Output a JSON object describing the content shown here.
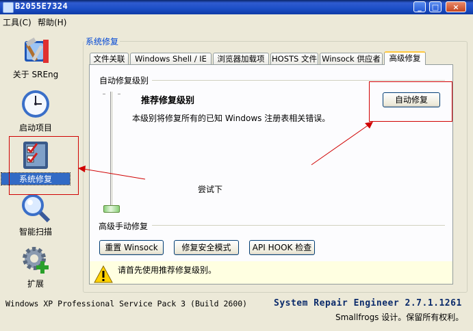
{
  "window": {
    "title": "B2055E7324",
    "controls": {
      "minimize": "_",
      "maximize": "□",
      "close": "×"
    }
  },
  "menu": [
    "工具(C)",
    "帮助(H)"
  ],
  "nav": [
    {
      "label": "关于 SREng",
      "icon": "hammer-wrench-icon"
    },
    {
      "label": "启动项目",
      "icon": "clock-icon"
    },
    {
      "label": "系统修复",
      "icon": "checklist-icon",
      "selected": true
    },
    {
      "label": "智能扫描",
      "icon": "magnifier-icon"
    },
    {
      "label": "扩展",
      "icon": "gear-plus-icon"
    }
  ],
  "group": {
    "title": "系统修复"
  },
  "tabs": [
    "文件关联",
    "Windows Shell / IE",
    "浏览器加载项",
    "HOSTS 文件",
    "Winsock 供应者",
    "高级修复"
  ],
  "auto_repair": {
    "section_label": "自动修复级别",
    "level_title": "推荐修复级别",
    "level_desc": "本级别将修复所有的已知 Windows 注册表相关错误。",
    "button": "自动修复"
  },
  "annotation": {
    "text": "尝试下"
  },
  "manual_repair": {
    "section_label": "高级手动修复",
    "buttons": [
      "重置 Winsock",
      "修复安全模式",
      "API HOOK 检查"
    ]
  },
  "notice": {
    "text": "请首先使用推荐修复级别。",
    "icon": "warning-icon"
  },
  "status": {
    "os": "Windows XP Professional Service Pack 3 (Build 2600)",
    "product": "System Repair Engineer 2.7.1.1261",
    "copyright": "Smallfrogs 设计。保留所有权利。"
  },
  "colors": {
    "accent": "#0046d5",
    "annotation": "#d00000",
    "selection": "#316ac5"
  }
}
